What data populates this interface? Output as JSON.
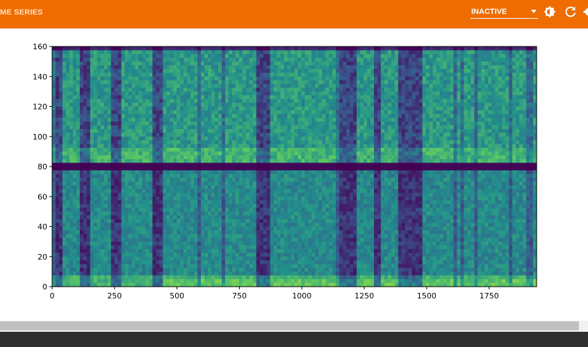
{
  "header": {
    "title": "ME SERIES",
    "run_selector": {
      "selected": "INACTIVE"
    },
    "icons": [
      "brightness-icon",
      "refresh-icon",
      "settings-icon"
    ],
    "accent_color": "#ef6c00"
  },
  "chart_data": {
    "type": "heatmap",
    "title": "",
    "xlabel": "",
    "ylabel": "",
    "xlim": [
      0,
      1940
    ],
    "ylim": [
      0,
      160
    ],
    "x_ticks": [
      "0",
      "250",
      "500",
      "750",
      "1000",
      "1250",
      "1500",
      "1750"
    ],
    "y_ticks": [
      "0",
      "20",
      "40",
      "60",
      "80",
      "100",
      "120",
      "140",
      "160"
    ],
    "colormap": "viridis",
    "description_bins": {
      "dark_band_y": 79.5,
      "dark_columns_x": [
        28,
        130,
        260,
        420,
        830,
        860,
        1165,
        1200,
        1300,
        1400,
        1430,
        1460
      ]
    }
  }
}
